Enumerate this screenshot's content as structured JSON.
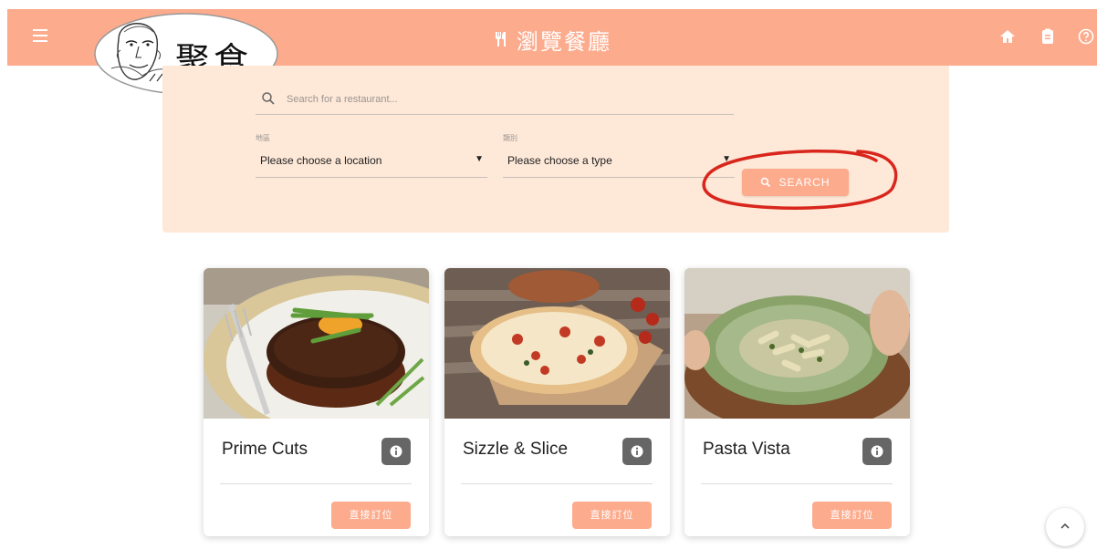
{
  "header": {
    "title": "瀏覽餐廳",
    "background_color": "#fdab8d",
    "icons": [
      "menu-icon",
      "fork-knife-icon",
      "home-icon",
      "clipboard-icon",
      "help-icon"
    ]
  },
  "logo": {
    "text": "聚食"
  },
  "search": {
    "placeholder": "Search for a restaurant...",
    "location_label": "地區",
    "location_value": "Please choose a location",
    "type_label": "類別",
    "type_value": "Please choose a type",
    "button_label": "SEARCH",
    "panel_color": "#fee8d8",
    "annotation_color": "#d9261c"
  },
  "restaurants": [
    {
      "name": "Prime Cuts",
      "book_label": "直接訂位",
      "photo": "steak"
    },
    {
      "name": "Sizzle & Slice",
      "book_label": "直接訂位",
      "photo": "pizza"
    },
    {
      "name": "Pasta Vista",
      "book_label": "直接訂位",
      "photo": "pasta"
    }
  ]
}
